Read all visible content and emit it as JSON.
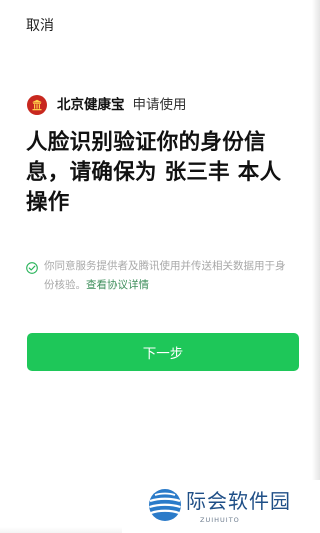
{
  "nav": {
    "cancel_label": "取消"
  },
  "app": {
    "name": "北京健康宝",
    "request_label": "申请使用",
    "logo_icon": "beijing-health-logo-icon",
    "logo_color": "#c8281f"
  },
  "main": {
    "headline": "人脸识别验证你的身份信息，请确保为 张三丰 本人操作"
  },
  "agreement": {
    "text": "你同意服务提供者及腾讯使用并传送相关数据用于身份核验。",
    "link_label": "查看协议详情",
    "checked": true,
    "check_icon": "check-circle-icon"
  },
  "actions": {
    "next_label": "下一步",
    "next_color": "#1ec759"
  },
  "watermark": {
    "title": "际会软件园",
    "subtitle": "ZUIHUITO",
    "logo_icon": "globe-logo-icon"
  }
}
